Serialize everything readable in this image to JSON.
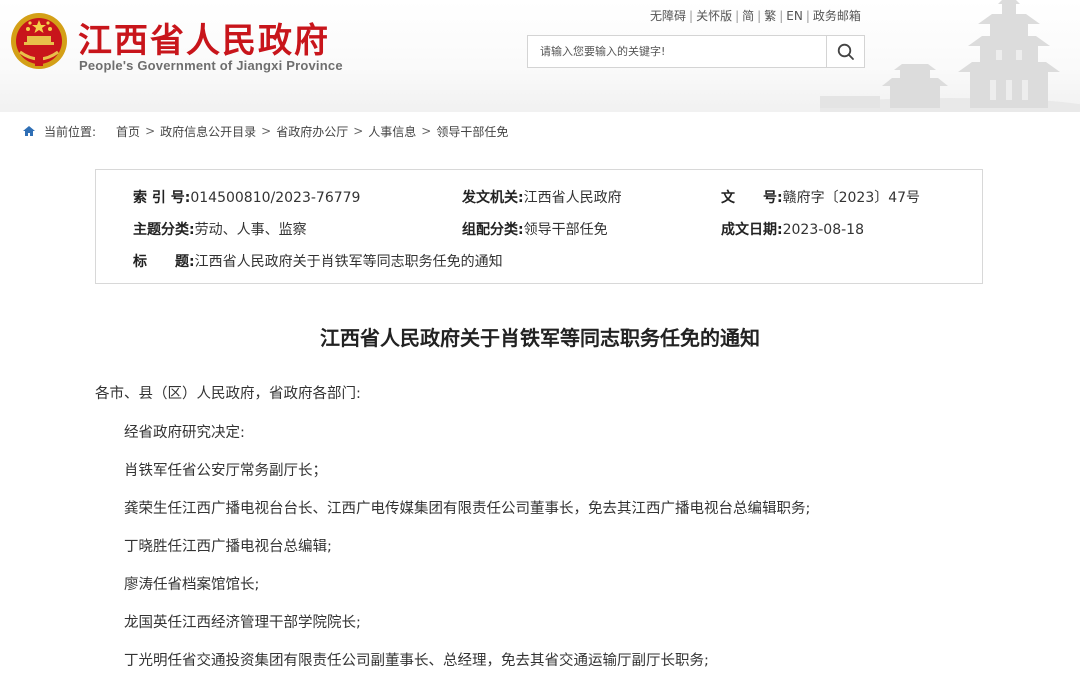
{
  "header": {
    "title": "江西省人民政府",
    "subtitle": "People's Government of Jiangxi Province",
    "top_links": [
      "无障碍",
      "关怀版",
      "简",
      "繁",
      "EN",
      "政务邮箱"
    ],
    "search_placeholder": "请输入您要输入的关键字!"
  },
  "breadcrumb": {
    "label": "当前位置:",
    "items": [
      "首页",
      "政府信息公开目录",
      "省政府办公厅",
      "人事信息",
      "领导干部任免"
    ]
  },
  "meta": {
    "index_label": "索 引 号:",
    "index_value": "014500810/2023-76779",
    "issuer_label": "发文机关:",
    "issuer_value": "江西省人民政府",
    "docno_label": "文　　号:",
    "docno_value": "赣府字〔2023〕47号",
    "topic_label": "主题分类:",
    "topic_value": "劳动、人事、监察",
    "category_label": "组配分类:",
    "category_value": "领导干部任免",
    "date_label": "成文日期:",
    "date_value": "2023-08-18",
    "title_label": "标　　题:",
    "title_value": "江西省人民政府关于肖铁军等同志职务任免的通知"
  },
  "article": {
    "title": "江西省人民政府关于肖铁军等同志职务任免的通知",
    "salutation": "各市、县（区）人民政府，省政府各部门:",
    "paragraphs": [
      "经省政府研究决定:",
      "肖铁军任省公安厅常务副厅长；",
      "龚荣生任江西广播电视台台长、江西广电传媒集团有限责任公司董事长，免去其江西广播电视台总编辑职务;",
      "丁晓胜任江西广播电视台总编辑;",
      "廖涛任省档案馆馆长;",
      "龙国英任江西经济管理干部学院院长;",
      "丁光明任省交通投资集团有限责任公司副董事长、总经理，免去其省交通运输厅副厅长职务;"
    ]
  },
  "colors": {
    "brand_red": "#c8151b"
  }
}
